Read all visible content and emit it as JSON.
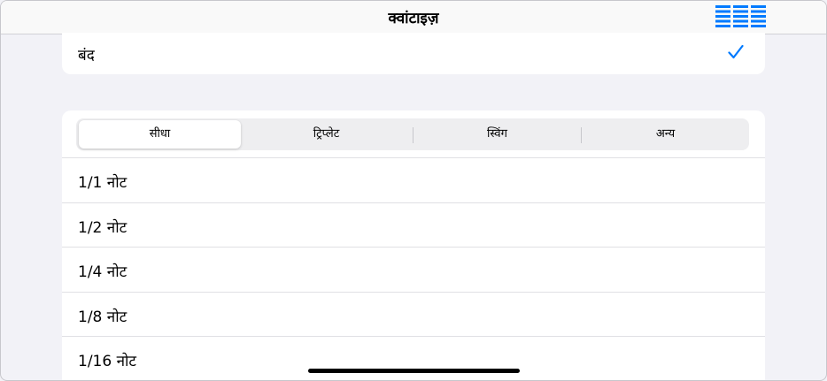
{
  "nav": {
    "title": "क्वांटाइज़",
    "menu_icon": "grid-list-icon"
  },
  "off_option": {
    "label": "बंद",
    "checked": true,
    "check_icon": "checkmark-icon"
  },
  "segments": [
    {
      "label": "सीधा",
      "selected": true
    },
    {
      "label": "ट्रिप्लेट",
      "selected": false
    },
    {
      "label": "स्विंग",
      "selected": false
    },
    {
      "label": "अन्य",
      "selected": false
    }
  ],
  "note_values": [
    "1/1 नोट",
    "1/2 नोट",
    "1/4 नोट",
    "1/8 नोट",
    "1/16 नोट"
  ],
  "colors": {
    "accent": "#007aff",
    "background": "#f2f2f7",
    "card": "#ffffff"
  }
}
